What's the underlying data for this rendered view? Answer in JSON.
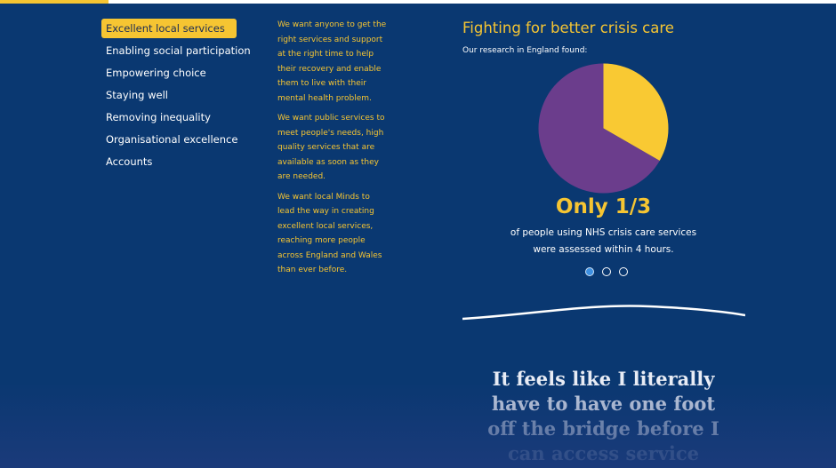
{
  "nav": {
    "items": [
      {
        "label": "Excellent local services",
        "active": true
      },
      {
        "label": "Enabling social participation",
        "active": false
      },
      {
        "label": "Empowering choice",
        "active": false
      },
      {
        "label": "Staying well",
        "active": false
      },
      {
        "label": "Removing inequality",
        "active": false
      },
      {
        "label": "Organisational excellence",
        "active": false
      },
      {
        "label": "Accounts",
        "active": false
      }
    ]
  },
  "intro": {
    "paragraphs": [
      "We want anyone to get the right services and support at the right time to help their recovery and enable them to live with their mental health problem.",
      "We want public services to meet people's needs, high quality services that are available as soon as they are needed.",
      "We want local Minds to lead the way in creating excellent local services, reaching more people across England and Wales than ever before."
    ]
  },
  "feature": {
    "title": "Fighting for better crisis care",
    "subtitle": "Our research in England found:",
    "stat_big": "Only 1/3",
    "stat_text": "of people using NHS crisis care services were assessed within 4 hours."
  },
  "chart_data": {
    "type": "pie",
    "values": [
      1,
      2
    ],
    "colors": [
      "#f9c933",
      "#6b3d8c"
    ]
  },
  "carousel": {
    "slide_count": 3,
    "active_index": 0
  },
  "quote": {
    "lines": [
      "It feels like I literally",
      "have to have one foot",
      "off the bridge before I",
      "can access service"
    ]
  },
  "colors": {
    "background": "#0a3871",
    "accent_yellow": "#f6c532",
    "text_white": "#ffffff"
  }
}
